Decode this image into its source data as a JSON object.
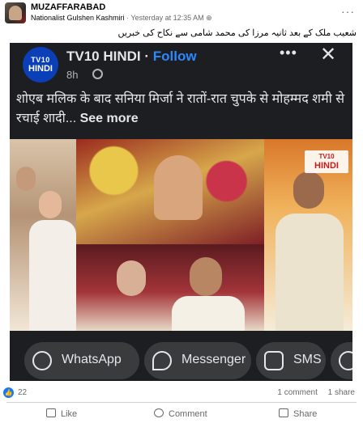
{
  "header": {
    "group_name": "MUZAFFARABAD",
    "author": "Nationalist Gulshen Kashmiri",
    "timestamp": "Yesterday at 12:35 AM",
    "separator": "·",
    "more_label": "···"
  },
  "caption": "شعیب ملک کے بعد ثانیہ مرزا کی محمد شامی سے نکاح کی خبریں",
  "embedded": {
    "logo_top": "TV10",
    "logo_bottom": "HINDI",
    "page_name": "TV10 HINDI",
    "dot": "·",
    "follow_label": "Follow",
    "time": "8h",
    "more_label": "•••",
    "close_label": "✕",
    "headline": "शोएब मलिक के बाद सनिया मिर्जा ने रातों-रात चुपके से मोहम्मद शमी से रचाई शादी...",
    "see_more": "See more",
    "watermark_top": "TV10",
    "watermark_bottom": "HINDI",
    "share_buttons": [
      {
        "label": "WhatsApp",
        "icon": "whatsapp-icon"
      },
      {
        "label": "Messenger",
        "icon": "messenger-icon"
      },
      {
        "label": "SMS",
        "icon": "sms-icon"
      },
      {
        "label": "",
        "icon": "link-icon"
      }
    ]
  },
  "footer": {
    "reaction_count": "22",
    "comments": "1 comment",
    "shares": "1 share",
    "actions": [
      {
        "label": "Like",
        "icon": "like-icon"
      },
      {
        "label": "Comment",
        "icon": "comment-icon"
      },
      {
        "label": "Share",
        "icon": "share-icon"
      }
    ]
  },
  "colors": {
    "facebook_blue": "#1877f2",
    "follow_blue": "#2d88ff",
    "dark_bg": "#1c1e21",
    "tv10_red": "#c41b1b"
  }
}
